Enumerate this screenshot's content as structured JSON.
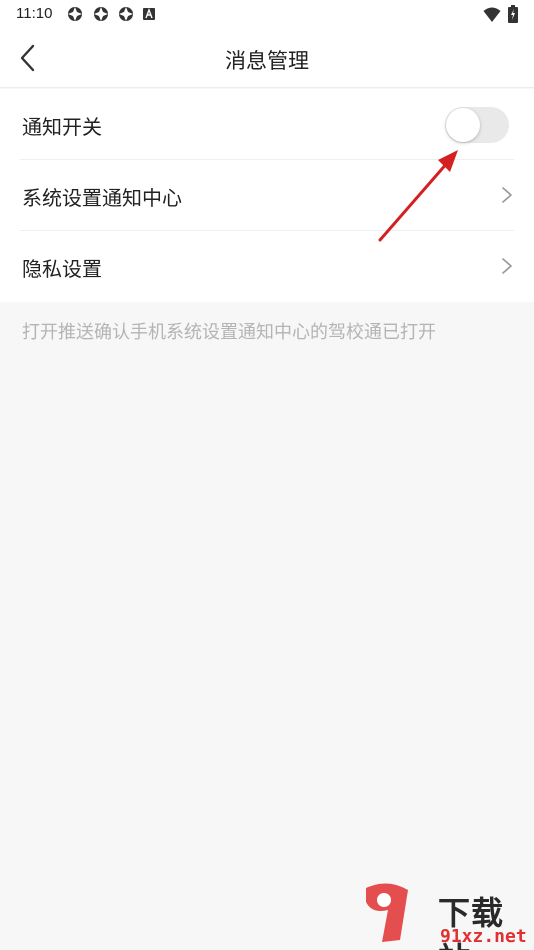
{
  "status_bar": {
    "time": "11:10",
    "icons": [
      "app-icon",
      "app-icon",
      "app-icon",
      "a-icon"
    ],
    "right_icons": [
      "wifi-icon",
      "battery-icon"
    ]
  },
  "nav": {
    "title": "消息管理",
    "back_icon": "chevron-left-icon"
  },
  "settings": {
    "items": [
      {
        "label": "通知开关",
        "control": "toggle",
        "enabled": false
      },
      {
        "label": "系统设置通知中心",
        "control": "chevron-right-icon"
      },
      {
        "label": "隐私设置",
        "control": "chevron-right-icon"
      }
    ]
  },
  "hint": "打开推送确认手机系统设置通知中心的驾校通已打开",
  "watermark": {
    "brand": "下载站",
    "domain": "91xz.net"
  },
  "colors": {
    "background": "#f7f7f7",
    "surface": "#ffffff",
    "toggle_off": "#e9e9e9",
    "hint_text": "#b4b4b4",
    "arrow_annotation": "#d42020"
  }
}
